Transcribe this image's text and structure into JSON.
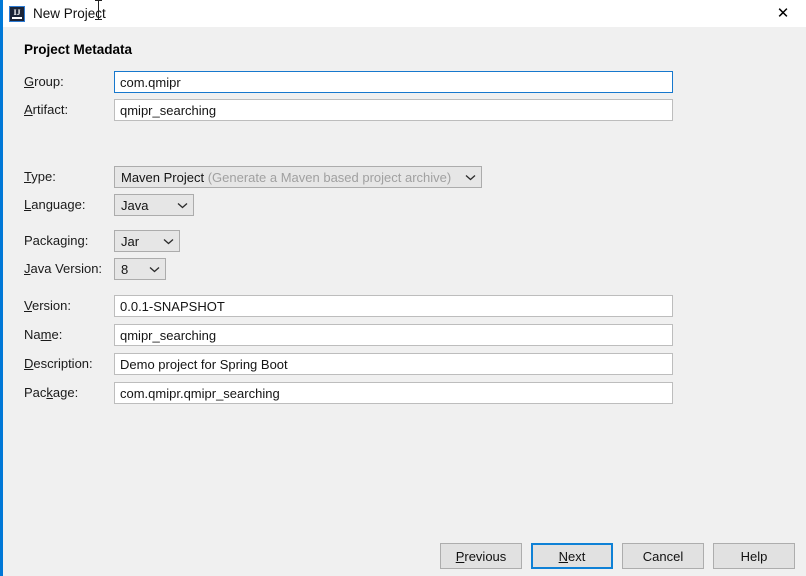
{
  "window": {
    "title": "New Project",
    "app_icon": "intellij-idea-icon",
    "icon_letters": "IJ",
    "close_label": "✕"
  },
  "dialog": {
    "section_title": "Project Metadata",
    "fields": {
      "group": {
        "label_before": "",
        "mnemonic": "G",
        "label_after": "roup:",
        "value": "com.qmipr",
        "focused": true
      },
      "artifact": {
        "mnemonic": "A",
        "label_after": "rtifact:",
        "value": "qmipr_searching",
        "focused": false
      },
      "type": {
        "mnemonic": "T",
        "label_after": "ype:",
        "value_main": "Maven Project",
        "value_hint": "(Generate a Maven based project archive)"
      },
      "language": {
        "mnemonic": "L",
        "label_after": "anguage:",
        "value": "Java"
      },
      "packaging": {
        "label_before": "Packa",
        "mnemonic": "g",
        "label_after": "ing:",
        "value": "Jar"
      },
      "java_version": {
        "mnemonic": "J",
        "label_after": "ava Version:",
        "value": "8"
      },
      "version": {
        "mnemonic": "V",
        "label_after": "ersion:",
        "value": "0.0.1-SNAPSHOT"
      },
      "name": {
        "label_before": "Na",
        "mnemonic": "m",
        "label_after": "e:",
        "value": "qmipr_searching"
      },
      "description": {
        "mnemonic": "D",
        "label_after": "escription:",
        "value": "Demo project for Spring Boot"
      },
      "package": {
        "label_before": "Pac",
        "mnemonic": "k",
        "label_after": "age:",
        "value": "com.qmipr.qmipr_searching"
      }
    },
    "buttons": {
      "previous": {
        "mnemonic": "P",
        "label_after": "revious",
        "focused": false
      },
      "next": {
        "mnemonic": "N",
        "label_after": "ext",
        "focused": true
      },
      "cancel": {
        "label": "Cancel",
        "focused": false
      },
      "help": {
        "label": "Help",
        "focused": false
      }
    }
  },
  "colors": {
    "accent_focus": "#0f81d6",
    "window_border": "#0078d7",
    "content_bg": "#f0f0f0",
    "titlebar_bg": "#ffffff",
    "input_bg": "#ffffff",
    "combo_bg": "#e6e6e6",
    "button_bg": "#e1e1e1",
    "hint_text": "#a0a0a0"
  }
}
